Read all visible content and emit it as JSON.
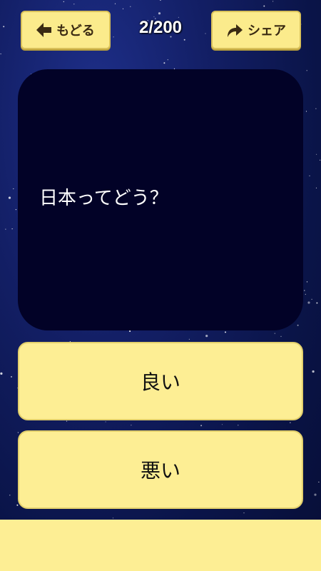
{
  "header": {
    "back_label": "もどる",
    "share_label": "シェア",
    "progress": "2/200"
  },
  "question": {
    "text": "日本ってどう？"
  },
  "answers": [
    {
      "label": "良い"
    },
    {
      "label": "悪い"
    }
  ],
  "colors": {
    "button_yellow": "#fbeb8c",
    "card_bg": "#020227",
    "sky_bg": "#131f66"
  },
  "icons": {
    "back": "arrow-left-icon",
    "share": "share-arrow-icon"
  }
}
